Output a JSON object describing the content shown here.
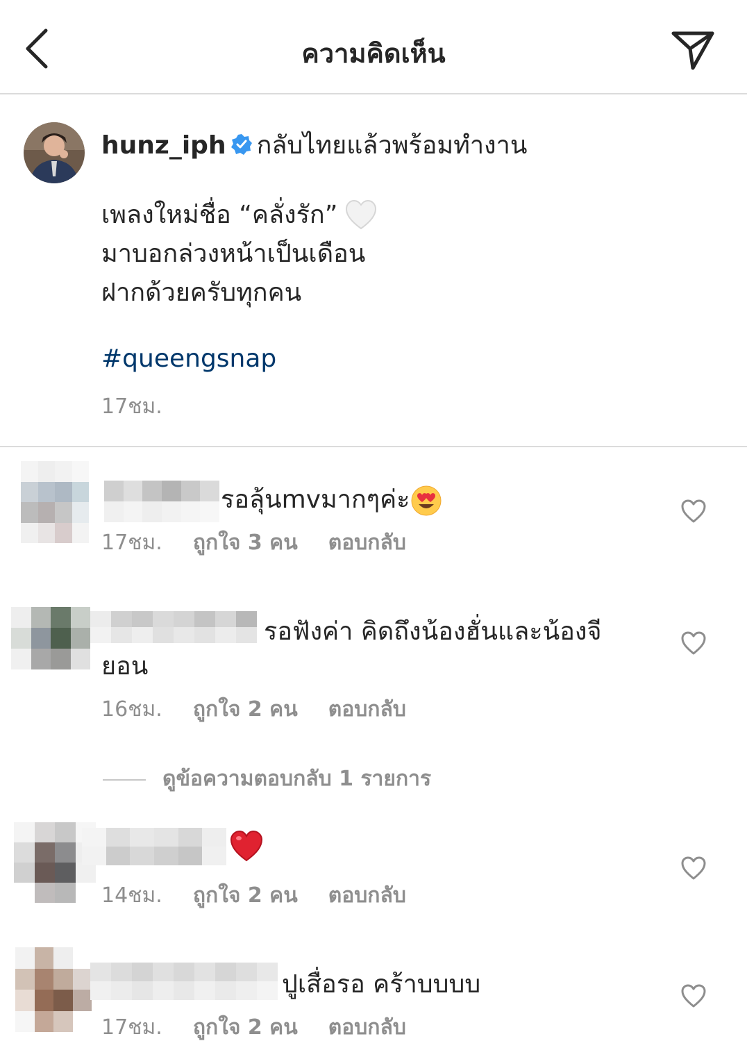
{
  "header": {
    "title": "ความคิดเห็น",
    "back_icon": "chevron-left-icon",
    "share_icon": "paper-plane-icon"
  },
  "caption": {
    "username": "hunz_iph",
    "verified": true,
    "line1": "กลับไทยแล้วพร้อมทำงาน",
    "body": "เพลงใหม่ชื่อ “คลั่งรัก”\nมาบอกล่วงหน้าเป็นเดือน\nฝากด้วยครับทุกคน",
    "emoji": "white-heart",
    "hashtag": "#queengsnap",
    "time": "17ชม."
  },
  "comments": [
    {
      "text": "รอลุ้นmvมากๆค่ะ",
      "emoji": "heart-eyes",
      "time": "17ชม.",
      "likes": "ถูกใจ 3 คน",
      "reply": "ตอบกลับ"
    },
    {
      "text": "รอฟังค่า คิดถึงน้องฮั่นและน้องจี",
      "text2": "ยอน",
      "time": "16ชม.",
      "likes": "ถูกใจ 2 คน",
      "reply": "ตอบกลับ",
      "view_replies": "ดูข้อความตอบกลับ 1 รายการ"
    },
    {
      "text": "",
      "emoji": "red-heart",
      "time": "14ชม.",
      "likes": "ถูกใจ 2 คน",
      "reply": "ตอบกลับ"
    },
    {
      "text": "ปูเสื่อรอ คร้าบบบบ",
      "time": "17ชม.",
      "likes": "ถูกใจ 2 คน",
      "reply": "ตอบกลับ"
    }
  ],
  "colors": {
    "verified": "#3897f0",
    "hashtag": "#00376b",
    "muted": "#8e8e8e",
    "divider": "#dbdbdb"
  }
}
